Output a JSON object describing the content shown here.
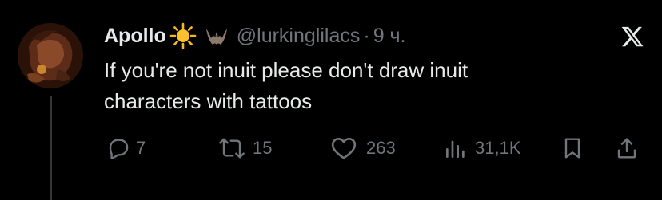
{
  "tweet": {
    "author_name": "Apollo",
    "author_emoji": "sun-emoji bat-emoji",
    "handle": "@lurkinglilacs",
    "separator": "·",
    "time": "9 ч.",
    "text": "If you're not inuit please don't draw inuit\ncharacters with tattoos"
  },
  "actions": {
    "replies": "7",
    "reposts": "15",
    "likes": "263",
    "views": "31,1K"
  },
  "icons": {
    "platform": "x-logo-icon",
    "reply": "speech-bubble-icon",
    "repost": "repost-arrows-icon",
    "like": "heart-icon",
    "views": "bar-chart-icon",
    "bookmark": "bookmark-icon",
    "share": "share-icon"
  },
  "colors": {
    "background": "#000000",
    "text_primary": "#e7e9ea",
    "text_secondary": "#71767b",
    "thread_line": "#333639"
  }
}
